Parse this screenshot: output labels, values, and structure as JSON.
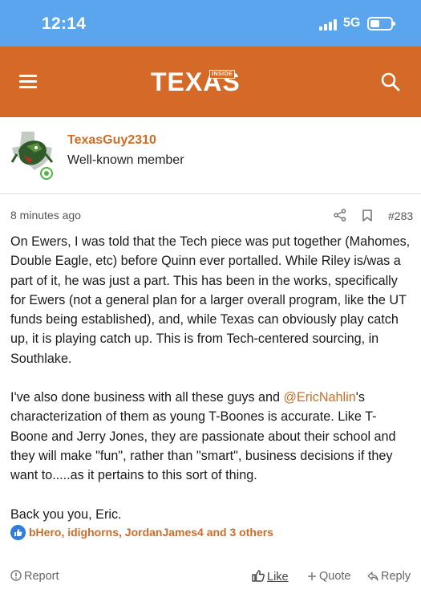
{
  "statusbar": {
    "time": "12:14",
    "network": "5G"
  },
  "header": {
    "logo_text": "TEXAS",
    "logo_inside": "INSIDE"
  },
  "member": {
    "username": "TexasGuy2310",
    "title": "Well-known member"
  },
  "post": {
    "time": "8 minutes ago",
    "number": "#283",
    "paragraph1": "On Ewers, I was told that the Tech piece was put together (Mahomes, Double Eagle, etc) before Quinn ever portalled. While Riley is/was a part of it, he was just a part. This has been in the works, specifically for Ewers (not a general plan for a larger overall program, like the UT funds being established), and, while Texas can obviously play catch up, it is playing catch up. This is from Tech-centered sourcing, in Southlake.",
    "paragraph2_before": "I've also done business with all these guys and ",
    "mention": "@EricNahlin",
    "paragraph2_after": "'s characterization of them as young T-Boones is accurate. Like T-Boone and Jerry Jones, they are passionate about their school and they will make \"fun\", rather than \"smart\", business decisions if they want to.....as it pertains to this sort of thing.",
    "paragraph3": "Back you you, Eric."
  },
  "reactions": {
    "names": "bHero, idighorns, JordanJames4 and 3 others"
  },
  "actions": {
    "report": "Report",
    "like": "Like",
    "quote": "Quote",
    "reply": "Reply"
  },
  "colors": {
    "header": "#d56a28",
    "statusbar": "#5aa5ee",
    "accent": "#cf6c25",
    "like_badge": "#2f7fd8"
  },
  "icons": [
    "menu-icon",
    "search-icon",
    "share-icon",
    "bookmark-icon",
    "like-icon",
    "report-icon",
    "plus-icon",
    "reply-icon"
  ]
}
